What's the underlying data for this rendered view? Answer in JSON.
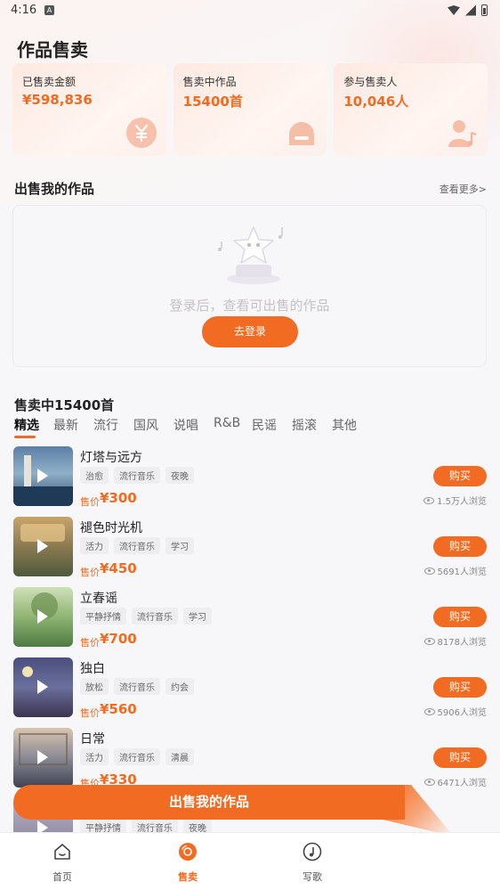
{
  "status_bar": {
    "time": "4:16"
  },
  "page_title": "作品售卖",
  "stats": [
    {
      "label": "已售卖金额",
      "value": "¥598,836",
      "icon": "yuan-coin-icon"
    },
    {
      "label": "售卖中作品",
      "value": "15400首",
      "icon": "record-player-icon"
    },
    {
      "label": "参与售卖人",
      "value": "10,046人",
      "icon": "person-music-icon"
    }
  ],
  "my_works": {
    "title": "出售我的作品",
    "more": "查看更多>",
    "empty_text": "登录后，查看可出售的作品",
    "login_button": "去登录"
  },
  "selling": {
    "title": "售卖中15400首",
    "tabs": [
      "精选",
      "最新",
      "流行",
      "国风",
      "说唱",
      "R&B",
      "民谣",
      "摇滚",
      "其他"
    ],
    "active_tab": "精选",
    "price_label": "售价",
    "buy_label": "购买",
    "items": [
      {
        "title": "灯塔与远方",
        "tags": [
          "治愈",
          "流行音乐",
          "夜晚"
        ],
        "price": "¥300",
        "views": "1.5万人浏览"
      },
      {
        "title": "褪色时光机",
        "tags": [
          "活力",
          "流行音乐",
          "学习"
        ],
        "price": "¥450",
        "views": "5691人浏览"
      },
      {
        "title": "立春谣",
        "tags": [
          "平静抒情",
          "流行音乐",
          "学习"
        ],
        "price": "¥700",
        "views": "8178人浏览"
      },
      {
        "title": "独白",
        "tags": [
          "放松",
          "流行音乐",
          "约会"
        ],
        "price": "¥560",
        "views": "5906人浏览"
      },
      {
        "title": "日常",
        "tags": [
          "活力",
          "流行音乐",
          "清晨"
        ],
        "price": "¥330",
        "views": "6471人浏览"
      },
      {
        "title": "",
        "tags": [
          "平静抒情",
          "流行音乐",
          "夜晚"
        ],
        "price": "",
        "views": ""
      }
    ]
  },
  "sell_button": "出售我的作品",
  "bottom_nav": [
    {
      "label": "首页",
      "icon": "home-icon",
      "active": false
    },
    {
      "label": "售卖",
      "icon": "record-icon",
      "active": true
    },
    {
      "label": "写歌",
      "icon": "music-note-icon",
      "active": false
    }
  ],
  "colors": {
    "accent": "#f26b22",
    "background": "#f7f6f8"
  }
}
